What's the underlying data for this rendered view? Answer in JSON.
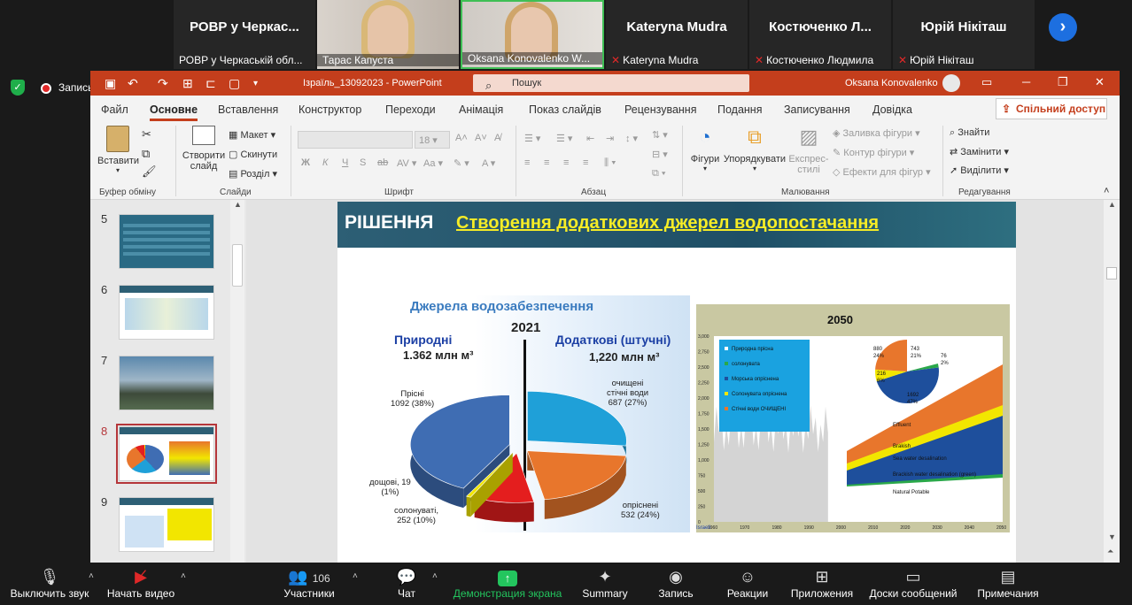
{
  "participants": [
    {
      "big": "РОВР  у  Черкас...",
      "caption": "РОВР у Черкаській обл..."
    },
    {
      "caption": "Тарас Капуста"
    },
    {
      "caption": "Oksana Konovalenko W..."
    },
    {
      "big": "Kateryna Mudra",
      "caption": "Kateryna Mudra"
    },
    {
      "big": "Костюченко  Л...",
      "caption": "Костюченко Людмила"
    },
    {
      "big": "Юрій Нікіташ",
      "caption": "Юрій Нікіташ"
    }
  ],
  "recording_label": "Запись",
  "ppt": {
    "doc_title": "Ізраїль_13092023  -  PowerPoint",
    "search_placeholder": "Пошук",
    "user_name": "Oksana Konovalenko",
    "tabs": [
      "Файл",
      "Основне",
      "Вставлення",
      "Конструктор",
      "Переходи",
      "Анімація",
      "Показ слайдів",
      "Рецензування",
      "Подання",
      "Записування",
      "Довідка"
    ],
    "share_label": "Спільний доступ",
    "ribbon": {
      "clipboard": {
        "paste": "Вставити",
        "label": "Буфер обміну"
      },
      "slides": {
        "new_slide_1": "Створити",
        "new_slide_2": "слайд",
        "layout": "Макет",
        "reset": "Скинути",
        "section": "Розділ",
        "label": "Слайди"
      },
      "font": {
        "size": "18",
        "label": "Шрифт"
      },
      "paragraph": {
        "label": "Абзац"
      },
      "drawing": {
        "shapes": "Фігури",
        "arrange": "Упорядкувати",
        "express_1": "Експрес-",
        "express_2": "стилі",
        "fill": "Заливка фігури",
        "outline": "Контур фігури",
        "effects": "Ефекти для фігур",
        "label": "Малювання"
      },
      "editing": {
        "find": "Знайти",
        "replace": "Замінити",
        "select": "Виділити",
        "label": "Редагування"
      }
    },
    "slide_numbers": [
      "5",
      "6",
      "7",
      "8",
      "9"
    ],
    "selected_slide": "8"
  },
  "slide": {
    "heading": "РІШЕННЯ",
    "title": "Створення додаткових джерел водопостачання",
    "pie": {
      "title": "Джерела  водозабезпечення",
      "year": "2021",
      "natural_label": "Природні",
      "natural_value": "1.362 млн м³",
      "artificial_label": "Додаткові (штучні)",
      "artificial_value": "1,220 млн м³",
      "slices": [
        {
          "label_1": "Прісні",
          "label_2": "1092 (38%)",
          "value": 1092,
          "color": "#3f6db3"
        },
        {
          "label_1": "очищені",
          "label_2": "стічні води",
          "label_3": "687 (27%)",
          "value": 687,
          "color": "#1fa0d8"
        },
        {
          "label_1": "опріснені",
          "label_2": "532 (24%)",
          "value": 532,
          "color": "#e8762c"
        },
        {
          "label_1": "солонуваті,",
          "label_2": "252 (10%)",
          "value": 252,
          "color": "#e41e1e"
        },
        {
          "label_1": "дощові, 19",
          "label_2": "(1%)",
          "value": 19,
          "color": "#f2e600"
        }
      ]
    },
    "chart2050": {
      "title": "2050",
      "legend": [
        "Природна прісна",
        "солонувата",
        "Морська опріснена",
        "Солонувата опріснена",
        "Стічні води ОЧИЩЕНІ"
      ],
      "legend_colors": [
        "#1e4f9c",
        "#2aa84a",
        "#1e4f9c",
        "#f2e600",
        "#e8762c"
      ],
      "yticks": [
        "3,000",
        "2,750",
        "2,500",
        "2,250",
        "2,000",
        "1,750",
        "1,500",
        "1,250",
        "1,000",
        "750",
        "500",
        "250",
        "0"
      ],
      "xticks": [
        "1960",
        "1970",
        "1980",
        "1990",
        "2000",
        "2010",
        "2020",
        "2030",
        "2040",
        "2050"
      ],
      "area_labels": [
        "Effluent",
        "Brakish",
        "Sea water desalination",
        "Brackish water desalination (green)",
        "Natural Potable"
      ],
      "pie_labels": [
        {
          "v": "743",
          "p": "21%"
        },
        {
          "v": "76",
          "p": "2%"
        },
        {
          "v": "1692",
          "p": "47%"
        },
        {
          "v": "216",
          "p": "6%"
        },
        {
          "v": "880",
          "p": "24%"
        }
      ],
      "source": "Israeli"
    }
  },
  "zoom_toolbar": {
    "mute": "Выключить звук",
    "video": "Начать видео",
    "participants": "Участники",
    "participants_count": "106",
    "chat": "Чат",
    "share": "Демонстрация экрана",
    "summary": "Summary",
    "record": "Запись",
    "reactions": "Реакции",
    "apps": "Приложения",
    "whiteboards": "Доски сообщений",
    "notes": "Примечания"
  }
}
